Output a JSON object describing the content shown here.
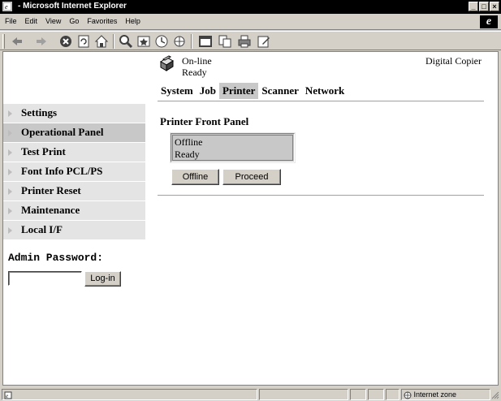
{
  "window": {
    "title": " - Microsoft Internet Explorer"
  },
  "menu": {
    "items": [
      "File",
      "Edit",
      "View",
      "Go",
      "Favorites",
      "Help"
    ]
  },
  "header": {
    "status_line1": "On-line",
    "status_line2": "Ready",
    "device_name": "Digital Copier"
  },
  "tabs": [
    "System",
    "Job",
    "Printer",
    "Scanner",
    "Network"
  ],
  "active_tab": "Printer",
  "sidebar": {
    "items": [
      {
        "label": "Settings"
      },
      {
        "label": "Operational Panel"
      },
      {
        "label": "Test Print"
      },
      {
        "label": "Font Info PCL/PS"
      },
      {
        "label": "Printer Reset"
      },
      {
        "label": "Maintenance"
      },
      {
        "label": "Local I/F"
      }
    ],
    "active_item": "Operational Panel"
  },
  "admin": {
    "label": "Admin Password:",
    "password_value": "",
    "login_label": "Log-in"
  },
  "panel": {
    "title": "Printer Front Panel",
    "display_line1": "Offline",
    "display_line2": "Ready",
    "offline_label": "Offline",
    "proceed_label": "Proceed"
  },
  "statusbar": {
    "zone": "Internet zone"
  },
  "colors": {
    "chrome": "#d4d0c8",
    "titlebar": "#000000",
    "active_highlight": "#c8c8c8",
    "sidebar_bg": "#e4e4e4"
  },
  "icons": [
    "ie-app-icon",
    "back-arrow-icon",
    "forward-arrow-icon",
    "stop-icon",
    "refresh-icon",
    "home-icon",
    "search-icon",
    "favorites-icon",
    "history-icon",
    "channels-icon",
    "fullscreen-icon",
    "mail-icon",
    "print-icon",
    "edit-icon",
    "printer-status-icon",
    "ie-logo-icon",
    "internet-zone-icon"
  ]
}
